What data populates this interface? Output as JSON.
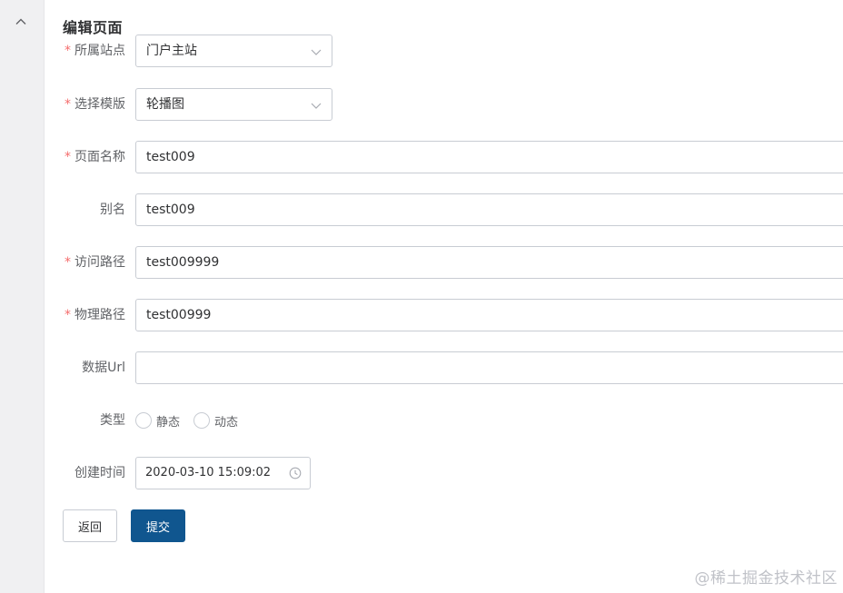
{
  "page": {
    "title": "编辑页面"
  },
  "form": {
    "site": {
      "label": "所属站点",
      "required_mark": "*",
      "value": "门户主站"
    },
    "template": {
      "label": "选择模版",
      "required_mark": "*",
      "value": "轮播图"
    },
    "page_name": {
      "label": "页面名称",
      "required_mark": "*",
      "value": "test009"
    },
    "alias": {
      "label": "别名",
      "value": "test009"
    },
    "access_path": {
      "label": "访问路径",
      "required_mark": "*",
      "value": "test009999"
    },
    "physical_path": {
      "label": "物理路径",
      "required_mark": "*",
      "value": "test00999"
    },
    "data_url": {
      "label": "数据Url",
      "value": ""
    },
    "type": {
      "label": "类型",
      "options": [
        {
          "label": "静态",
          "checked": false
        },
        {
          "label": "动态",
          "checked": false
        }
      ]
    },
    "created_time": {
      "label": "创建时间",
      "value": "2020-03-10 15:09:02"
    }
  },
  "actions": {
    "back_label": "返回",
    "submit_label": "提交"
  },
  "watermark": "@稀土掘金技术社区",
  "icons": {
    "collapse": "chevron-up-icon",
    "select_arrow": "chevron-down-icon",
    "time": "clock-icon"
  },
  "colors": {
    "primary": "#10568f",
    "required": "#f56c6c",
    "border": "#c8ccd3",
    "gutter": "#f0f0f2"
  }
}
